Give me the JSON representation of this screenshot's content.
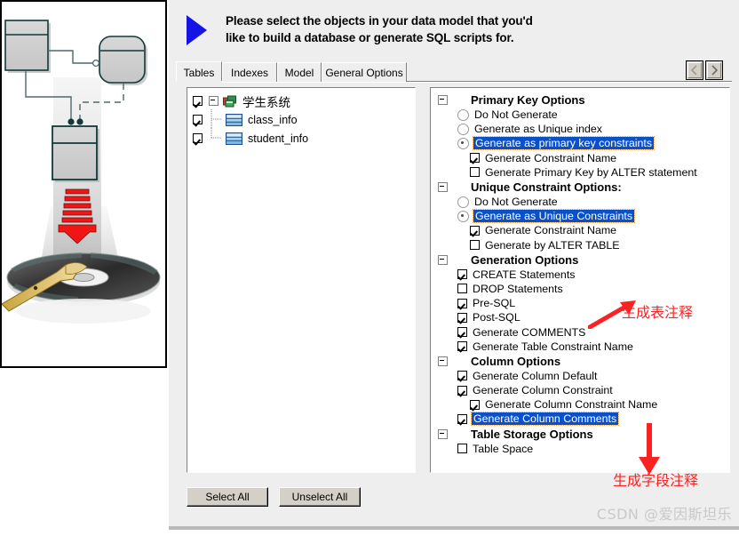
{
  "window": {
    "instruction_line1": "Please select the objects in your data model that you'd",
    "instruction_line2": "like to build a database or generate SQL scripts for.",
    "arrow_icon": "blue-right-triangle-icon"
  },
  "tabs": [
    {
      "label": "Tables",
      "active": true
    },
    {
      "label": "Indexes",
      "active": false
    },
    {
      "label": "Model",
      "active": false
    },
    {
      "label": "General Options",
      "active": false
    }
  ],
  "tab_scroll": {
    "left_label": "‹",
    "right_label": "›",
    "left_icon": "scroll-left-icon",
    "right_icon": "scroll-right-icon"
  },
  "tree": {
    "items": [
      {
        "label": "学生系统",
        "checked": true,
        "level": 0,
        "icon": "database-model-icon",
        "expander": "collapse-box"
      },
      {
        "label": "class_info",
        "checked": true,
        "level": 1,
        "icon": "table-icon"
      },
      {
        "label": "student_info",
        "checked": true,
        "level": 1,
        "icon": "table-icon"
      }
    ]
  },
  "options": {
    "groups": [
      {
        "title": "Primary Key Options",
        "rows": [
          {
            "type": "radio",
            "label": "Do Not Generate",
            "selected": false,
            "indent": 0
          },
          {
            "type": "radio",
            "label": "Generate as Unique index",
            "selected": false,
            "indent": 0
          },
          {
            "type": "radio",
            "label": "Generate as primary key constraints",
            "selected": true,
            "indent": 0
          },
          {
            "type": "check",
            "label": "Generate Constraint Name",
            "checked": true,
            "indent": 1
          },
          {
            "type": "check",
            "label": "Generate Primary Key by ALTER statement",
            "checked": false,
            "indent": 1
          }
        ]
      },
      {
        "title": "Unique Constraint Options:",
        "rows": [
          {
            "type": "radio",
            "label": "Do Not Generate",
            "selected": false,
            "indent": 0
          },
          {
            "type": "radio",
            "label": "Generate as Unique Constraints",
            "selected": true,
            "indent": 0
          },
          {
            "type": "check",
            "label": "Generate Constraint Name",
            "checked": true,
            "indent": 1
          },
          {
            "type": "check",
            "label": "Generate by ALTER TABLE",
            "checked": false,
            "indent": 1
          }
        ]
      },
      {
        "title": "Generation Options",
        "rows": [
          {
            "type": "check",
            "label": "CREATE Statements",
            "checked": true,
            "indent": 0
          },
          {
            "type": "check",
            "label": "DROP Statements",
            "checked": false,
            "indent": 0
          },
          {
            "type": "check",
            "label": "Pre-SQL",
            "checked": true,
            "indent": 0
          },
          {
            "type": "check",
            "label": "Post-SQL",
            "checked": true,
            "indent": 0
          },
          {
            "type": "check",
            "label": "Generate COMMENTS",
            "checked": true,
            "indent": 0
          },
          {
            "type": "check",
            "label": "Generate Table Constraint Name",
            "checked": true,
            "indent": 0
          }
        ]
      },
      {
        "title": "Column Options",
        "rows": [
          {
            "type": "check",
            "label": "Generate Column Default",
            "checked": true,
            "indent": 0
          },
          {
            "type": "check",
            "label": "Generate Column Constraint",
            "checked": true,
            "indent": 0
          },
          {
            "type": "check",
            "label": "Generate Column Constraint Name",
            "checked": true,
            "indent": 1
          },
          {
            "type": "check",
            "label": "Generate Column Comments",
            "checked": true,
            "indent": 0,
            "selected": true
          }
        ]
      },
      {
        "title": "Table Storage Options",
        "rows": [
          {
            "type": "check",
            "label": "Table Space",
            "checked": false,
            "indent": 0
          }
        ]
      }
    ]
  },
  "annotations": [
    {
      "text": "生成表注释",
      "color": "#fc2222",
      "arrow": "up-right-arrow"
    },
    {
      "text": "生成字段注释",
      "color": "#fc2222",
      "arrow": "down-arrow"
    }
  ],
  "buttons": {
    "select_all": "Select All",
    "unselect_all": "Unselect All"
  },
  "watermark": "CSDN @爱因斯坦乐"
}
